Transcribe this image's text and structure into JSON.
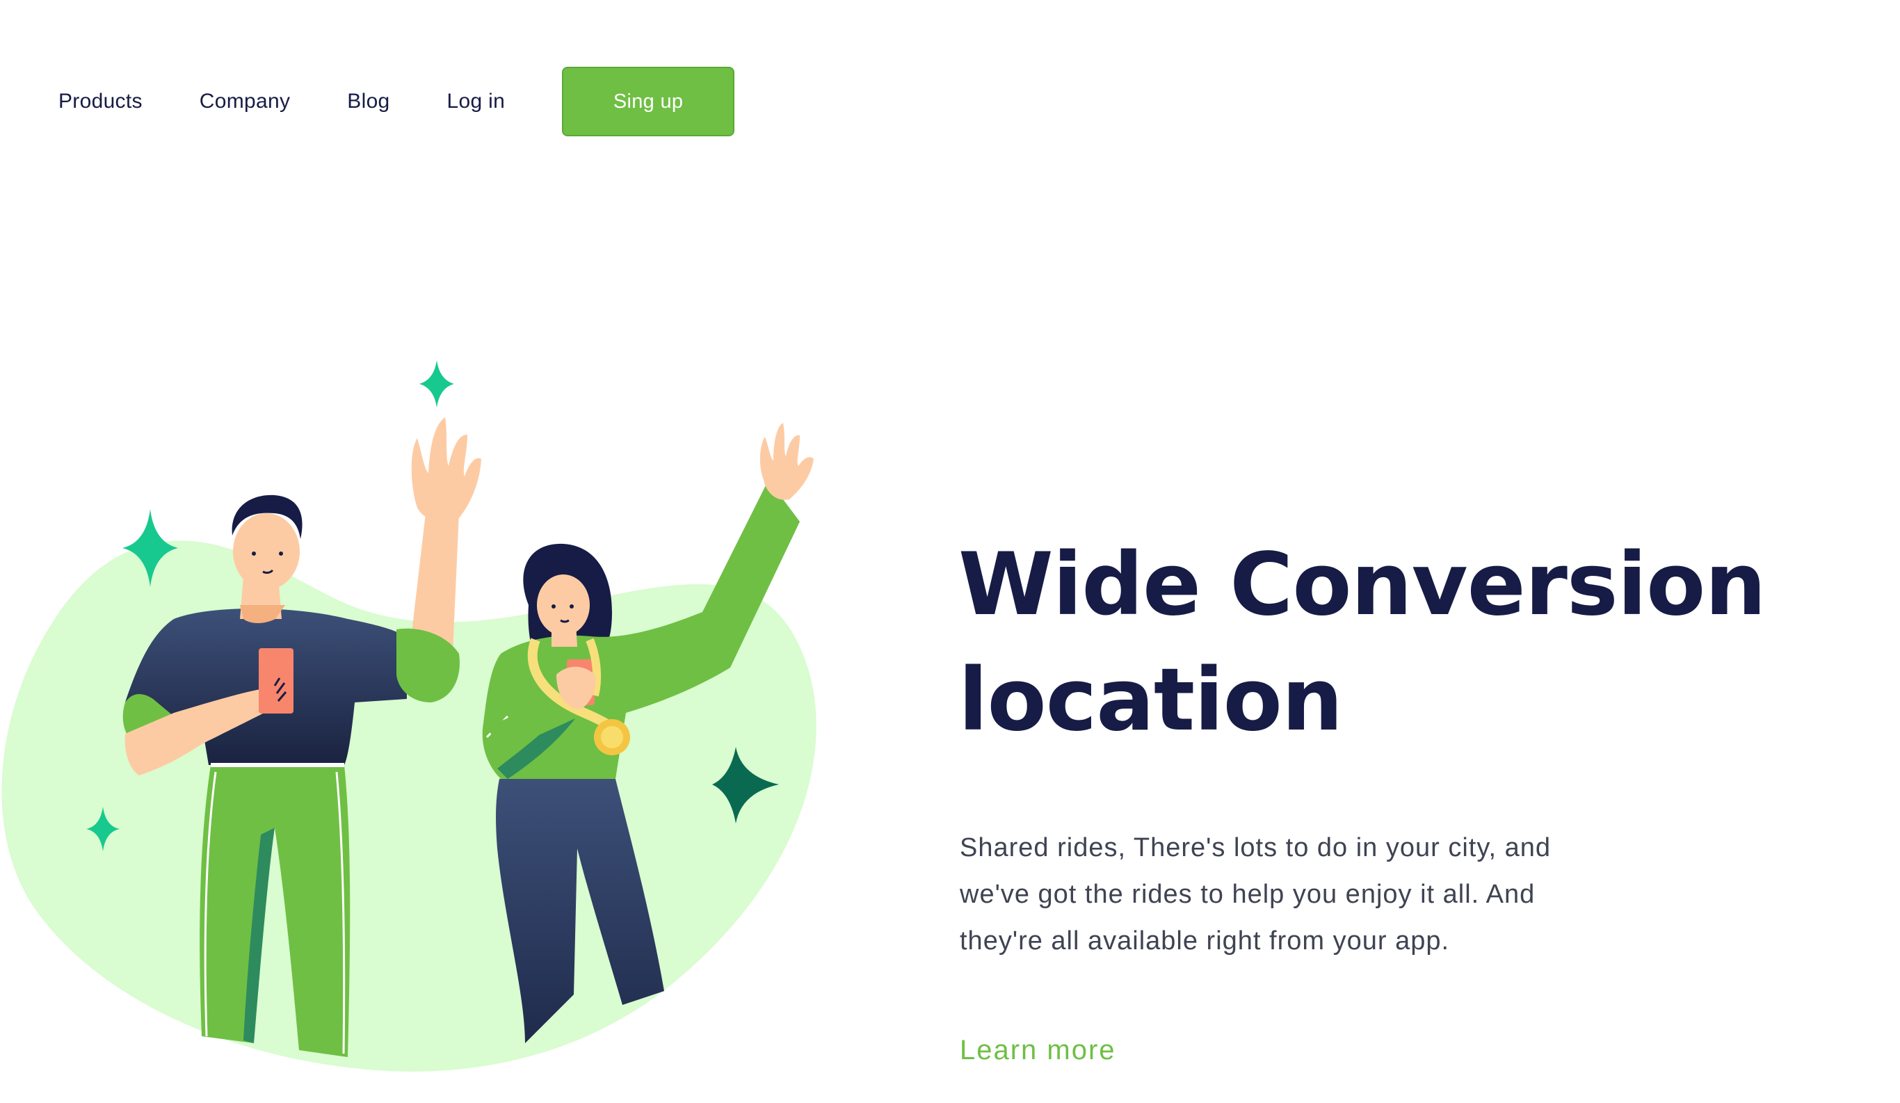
{
  "nav": {
    "items": [
      "Products",
      "Company",
      "Blog",
      "Log in"
    ],
    "signup_label": "Sing up"
  },
  "hero": {
    "title_line1": "Wide Conversion",
    "title_line2": "location",
    "description": "Shared rides, There's lots to do in your city, and we've got the rides to help you enjoy it all. And they're all available right from your app.",
    "cta_label": "Learn more"
  },
  "illustration": {
    "subject": "two-people-waving-illustration",
    "sparkles": [
      "sparkle-icon",
      "sparkle-icon",
      "sparkle-icon",
      "sparkle-icon"
    ]
  },
  "colors": {
    "brand_green": "#6fbf44",
    "navy": "#161c45",
    "body_text": "#3f4352",
    "blob_green": "#d9fcd0",
    "sparkle_green": "#17c98f",
    "sparkle_dark": "#0a6a51"
  }
}
